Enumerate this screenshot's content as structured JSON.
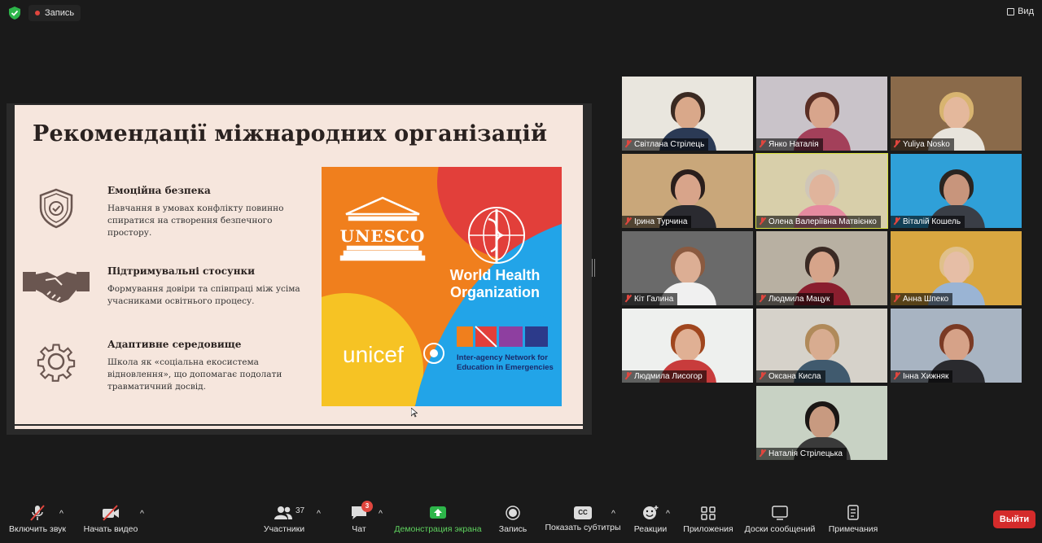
{
  "topbar": {
    "record_label": "Запись",
    "view_label": "Вид"
  },
  "slide": {
    "title": "Рекомендації міжнародних організацій",
    "items": [
      {
        "title": "Емоційна безпека",
        "text": "Навчання в умовах конфлікту повинно спиратися на створення безпечного простору.",
        "icon": "shield-check-icon"
      },
      {
        "title": "Підтримувальні стосунки",
        "text": "Формування довіри та співпраці між усіма учасниками освітнього процесу.",
        "icon": "handshake-icon"
      },
      {
        "title": "Адаптивне середовище",
        "text": "Школа як «соціальна екосистема відновлення», що допомагає подолати травматичний досвід.",
        "icon": "gear-icon"
      }
    ],
    "logos": {
      "unesco": "UNESCO",
      "who_line1": "World Health",
      "who_line2": "Organization",
      "unicef": "unicef",
      "inee_line1": "Inter-agency Network for",
      "inee_line2": "Education in Emergencies"
    }
  },
  "participants": [
    {
      "name": "Світлана Стрілець"
    },
    {
      "name": "Янко Наталія"
    },
    {
      "name": "Yuliya Nosko"
    },
    {
      "name": "Ірина Турчина"
    },
    {
      "name": "Олена Валеріївна Матвієнко",
      "active": true
    },
    {
      "name": "Віталій Кошель"
    },
    {
      "name": "Кіт Галина"
    },
    {
      "name": "Людмила Мацук"
    },
    {
      "name": "Анна Шпеко"
    },
    {
      "name": "Людмила Лисогор"
    },
    {
      "name": "Оксана Кисла"
    },
    {
      "name": "Інна Хижняк"
    },
    {
      "name": "Наталія Стрілецька"
    }
  ],
  "toolbar": {
    "audio": "Включить звук",
    "video": "Начать видео",
    "participants": "Участники",
    "participants_count": "37",
    "chat": "Чат",
    "chat_badge": "3",
    "share": "Демонстрация экрана",
    "record": "Запись",
    "captions": "Показать субтитры",
    "reactions": "Реакции",
    "apps": "Приложения",
    "whiteboards": "Доски сообщений",
    "notes": "Примечания",
    "leave": "Выйти",
    "cc": "CC"
  },
  "colors": {
    "accent_green": "#5fd35f",
    "leave_red": "#d42b2b",
    "active_border": "#d9e23f",
    "slide_bg": "#f6e6dd"
  }
}
